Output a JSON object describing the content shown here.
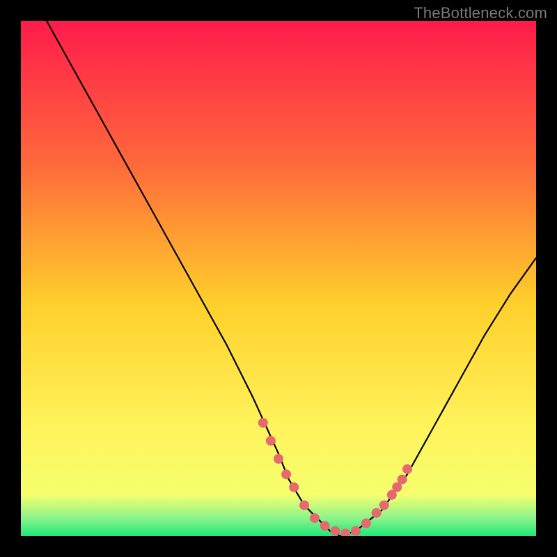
{
  "watermark": "TheBottleneck.com",
  "colors": {
    "bg_black": "#000000",
    "grad_top": "#ff1b4b",
    "grad_mid1": "#ff6a3a",
    "grad_mid2": "#ffd02b",
    "grad_mid3": "#fff25a",
    "grad_bottom_y": "#f6ff6e",
    "grad_green": "#1ee87a",
    "curve": "#000000",
    "dots": "#e46a6e"
  },
  "chart_data": {
    "type": "line",
    "title": "",
    "xlabel": "",
    "ylabel": "",
    "xlim": [
      0,
      100
    ],
    "ylim": [
      0,
      100
    ],
    "series": [
      {
        "name": "bottleneck-curve",
        "x": [
          5,
          10,
          15,
          20,
          25,
          30,
          35,
          40,
          45,
          50,
          52,
          55,
          58,
          60,
          62,
          65,
          70,
          75,
          80,
          85,
          90,
          95,
          100
        ],
        "y": [
          100,
          91,
          82,
          73,
          64,
          55,
          46,
          37,
          27,
          16,
          11,
          6,
          3,
          1,
          0,
          1,
          5,
          12,
          21,
          30,
          39,
          47,
          54
        ]
      }
    ],
    "highlight_points": {
      "name": "optimal-range-dots",
      "x": [
        47,
        48.5,
        50,
        51.5,
        53,
        55,
        57,
        59,
        61,
        63,
        65,
        67,
        69,
        70.5,
        72,
        73,
        74,
        75
      ],
      "y": [
        22,
        18.5,
        15,
        12,
        9.5,
        6,
        3.5,
        2,
        1,
        0.5,
        1,
        2.5,
        4.5,
        6,
        8,
        9.5,
        11,
        13
      ]
    },
    "green_band_y_range": [
      0,
      4
    ],
    "annotations": []
  }
}
